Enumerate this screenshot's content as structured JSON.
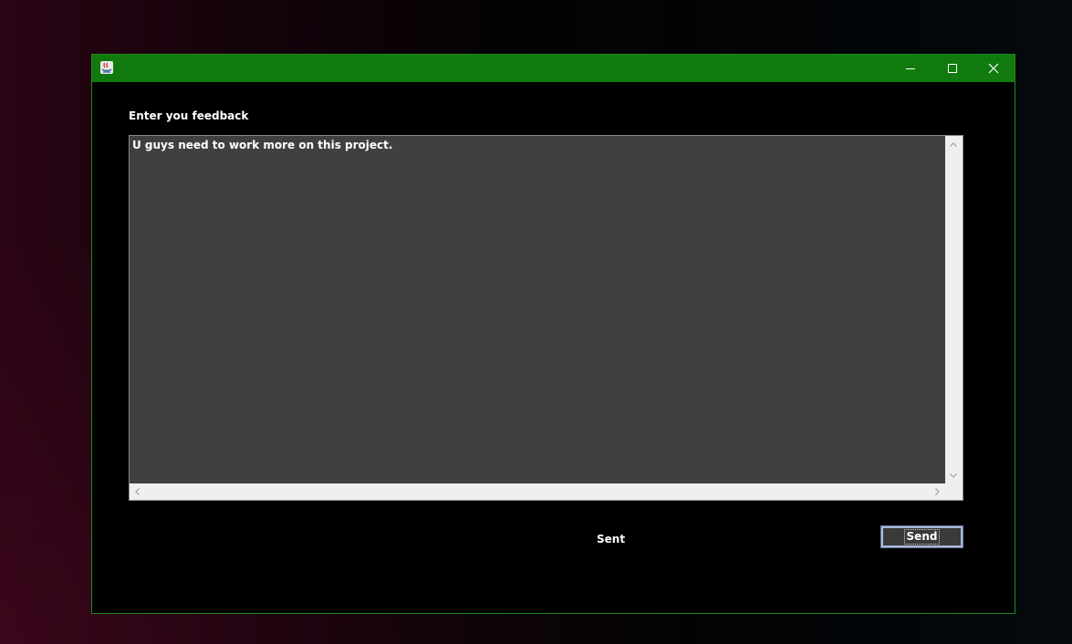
{
  "window": {
    "title": "",
    "icon": "java-app-icon",
    "controls": {
      "minimize": "minimize-icon",
      "maximize": "maximize-icon",
      "close": "close-icon"
    },
    "titlebar_color": "#117a0f",
    "border_color": "#1f8a1b"
  },
  "form": {
    "label": "Enter you feedback",
    "feedback_text": "U guys need to work more on this project.",
    "status": "Sent",
    "send_label": "Send"
  },
  "colors": {
    "textarea_bg": "#404040",
    "window_bg": "#000000",
    "text": "#ffffff"
  }
}
